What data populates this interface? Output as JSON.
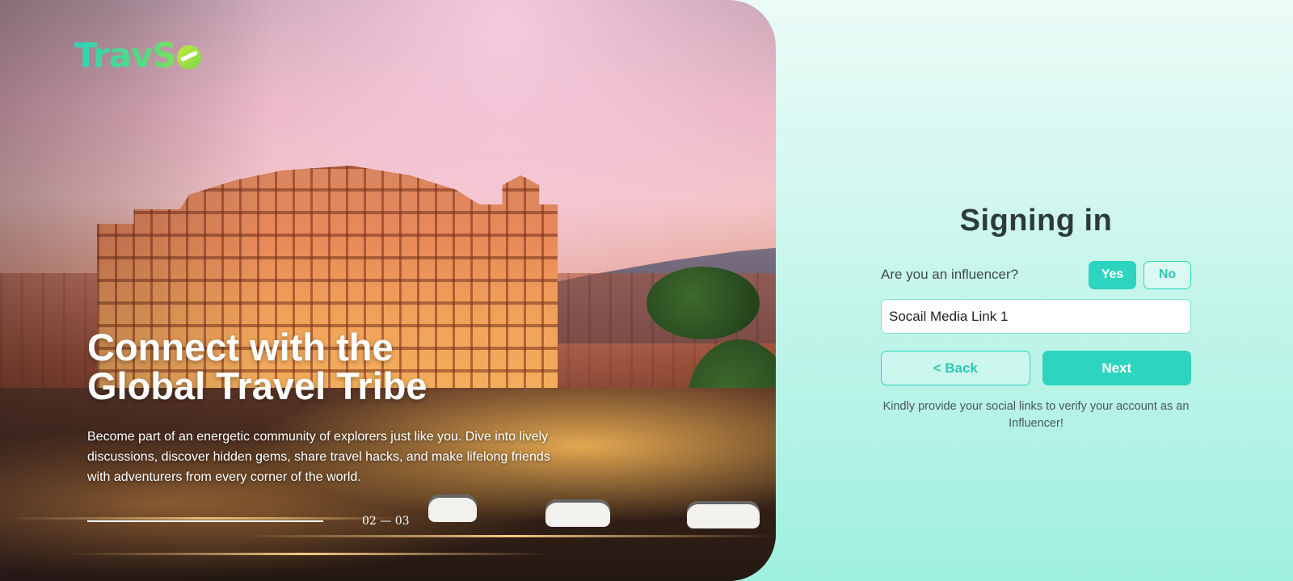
{
  "brand": {
    "logo_text": "TravS",
    "logo_suffix_icon": "globe-o-icon"
  },
  "hero": {
    "title_line1": "Connect with the",
    "title_line2": "Global Travel Tribe",
    "description": "Become part of an energetic community of explorers just like you. Dive into lively discussions, discover hidden gems, share travel hacks, and make lifelong friends with adventurers from every corner of the world.",
    "slide_indicator": "02 — 03",
    "progress_fraction": 1.0
  },
  "form": {
    "title": "Signing in",
    "influencer_question": "Are you an influencer?",
    "yes_label": "Yes",
    "no_label": "No",
    "selected_option": "Yes",
    "social_link_value": "Socail Media Link 1",
    "back_label": "< Back",
    "next_label": "Next",
    "helper_text": "Kindly provide your social links to verify your account as an Influencer!"
  },
  "colors": {
    "accent": "#2dd4bf",
    "title_text": "#2c3a3a",
    "background_top": "#ecfbf8",
    "background_bottom": "#9ff0de"
  }
}
